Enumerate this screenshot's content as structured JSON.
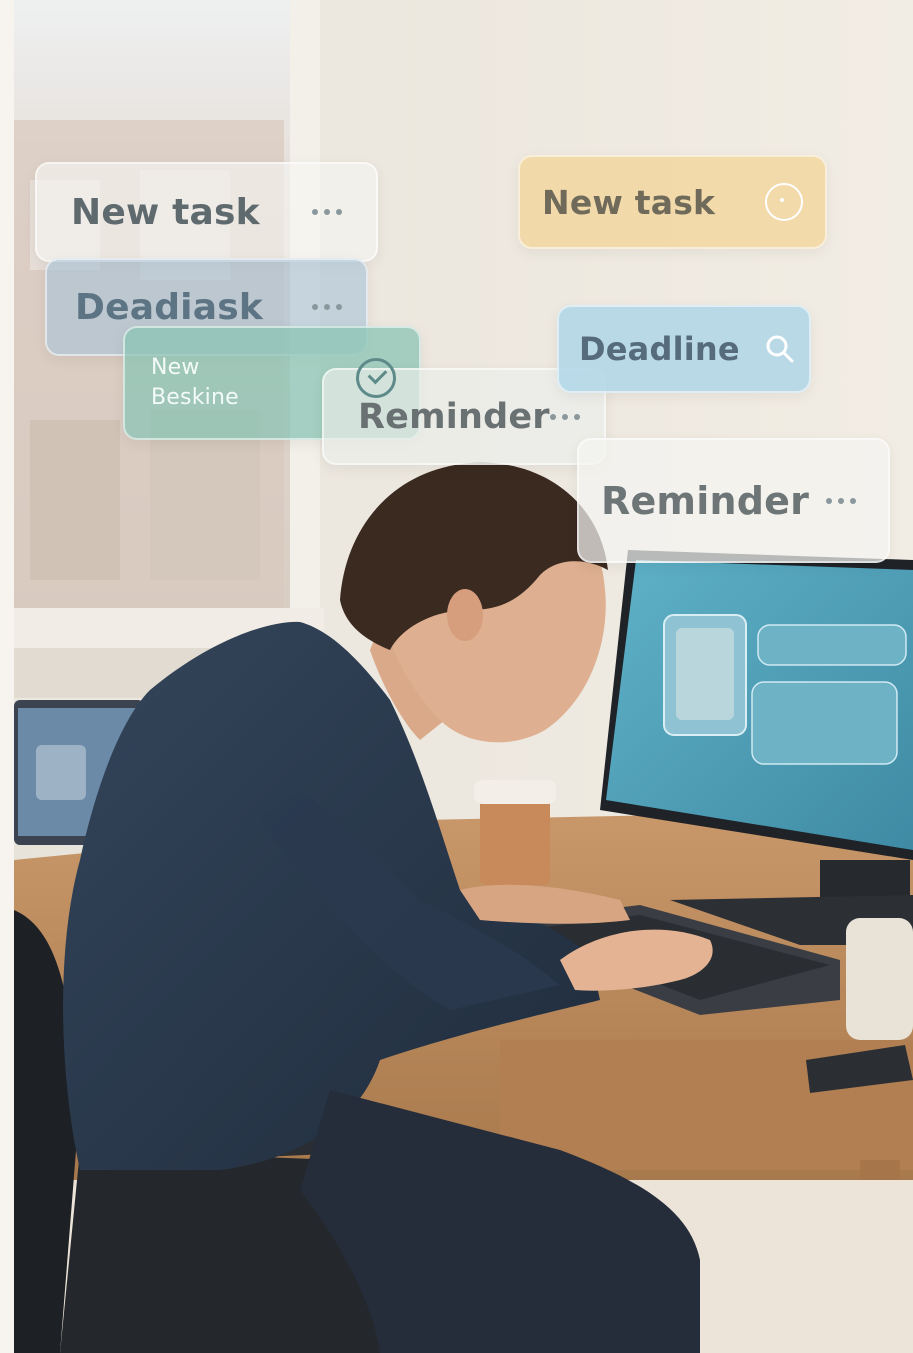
{
  "floating_cards": {
    "card1": {
      "label": "New task"
    },
    "card2": {
      "label": "Deadiask"
    },
    "card3": {
      "line1": "New",
      "line2": "Beskine"
    },
    "card4": {
      "label": "Reminder"
    },
    "card5": {
      "label": "New task"
    },
    "card6": {
      "label": "Deadline"
    },
    "card7": {
      "label": "Reminder"
    }
  },
  "colors": {
    "wall": "#efe9df",
    "desk": "#b9895a",
    "shirt": "#2b3a4e",
    "monitor_screen": "#4b9fb7"
  },
  "icons": [
    "more-dots-icon",
    "check-circle-icon",
    "circle-target-icon",
    "search-icon"
  ]
}
